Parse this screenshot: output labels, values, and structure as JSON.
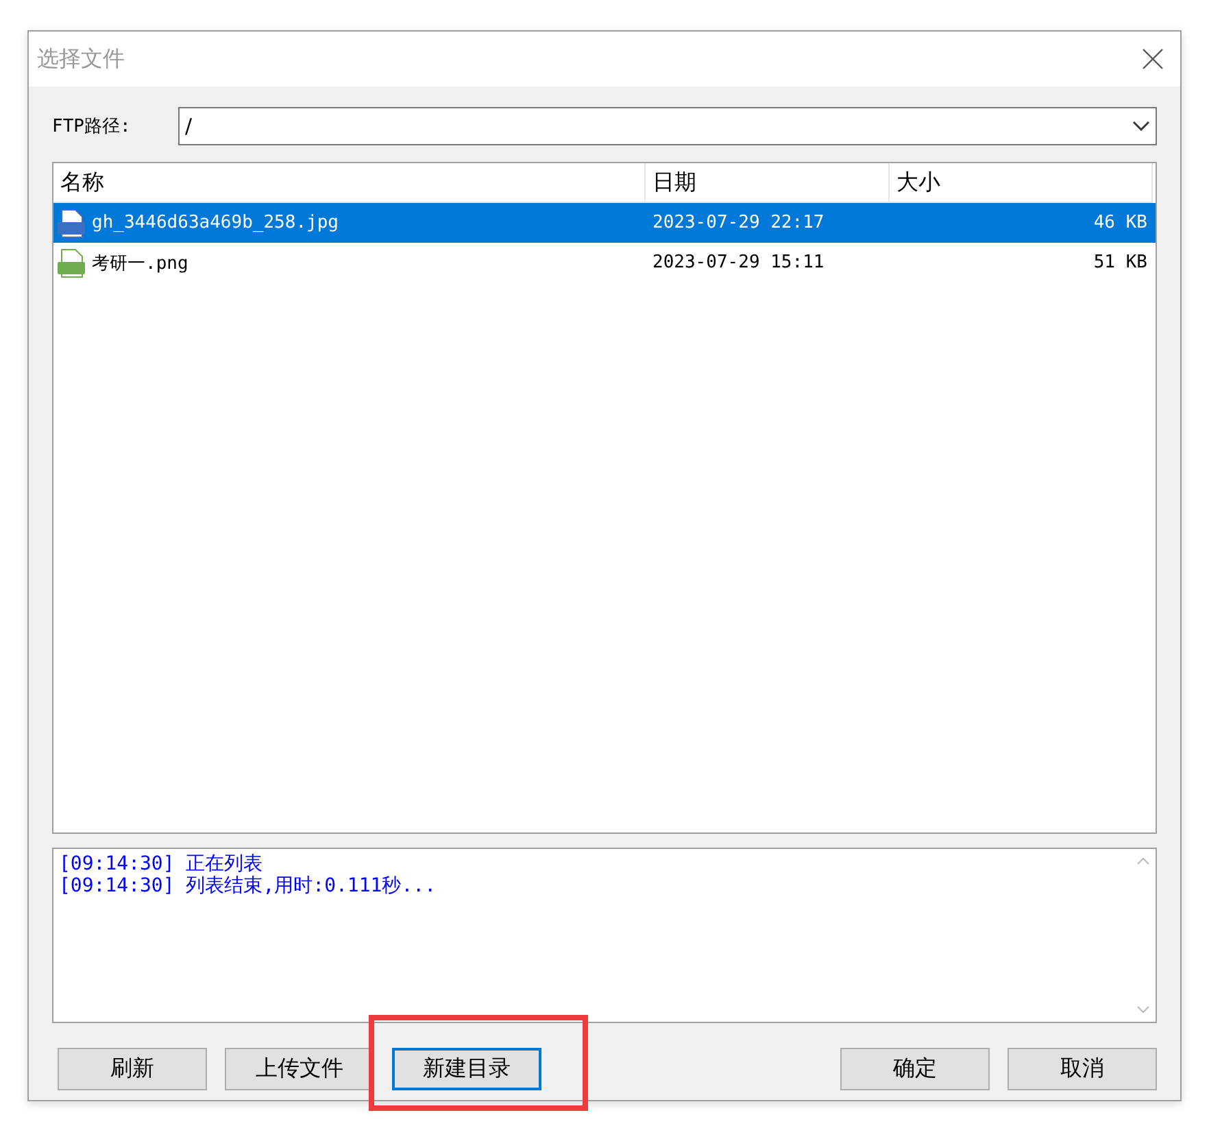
{
  "window": {
    "title": "选择文件"
  },
  "path": {
    "label": "FTP路径:",
    "value": "/"
  },
  "table": {
    "columns": [
      "名称",
      "日期",
      "大小"
    ],
    "rows": [
      {
        "kind": "jpg",
        "name": "gh_3446d63a469b_258.jpg",
        "date": "2023-07-29 22:17",
        "size": "46 KB",
        "selected": true
      },
      {
        "kind": "png",
        "name": "考研一.png",
        "date": "2023-07-29 15:11",
        "size": "51 KB",
        "selected": false
      }
    ]
  },
  "log": [
    "[09:14:30] 正在列表",
    "[09:14:30] 列表结束,用时:0.111秒..."
  ],
  "buttons_left": [
    {
      "label": "刷新",
      "focused": false,
      "highlighted": false
    },
    {
      "label": "上传文件",
      "focused": false,
      "highlighted": false
    },
    {
      "label": "新建目录",
      "focused": true,
      "highlighted": true
    }
  ],
  "buttons_right": [
    {
      "label": "确定",
      "focused": false,
      "highlighted": false
    },
    {
      "label": "取消",
      "focused": false,
      "highlighted": false
    }
  ]
}
